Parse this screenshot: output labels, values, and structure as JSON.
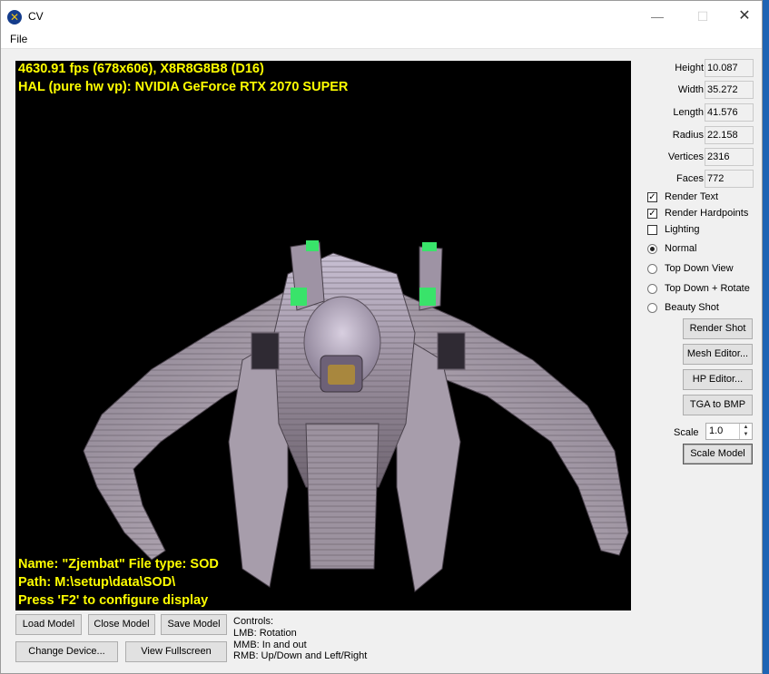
{
  "window": {
    "title": "CV",
    "app_icon_glyph": "✕",
    "minimize_glyph": "—",
    "maximize_glyph": "☐",
    "close_glyph": "✕"
  },
  "menu": {
    "file": "File"
  },
  "viewport": {
    "line1": "4630.91 fps (678x606), X8R8G8B8 (D16)",
    "line2": "HAL (pure hw vp): NVIDIA GeForce RTX 2070 SUPER",
    "name_line": "Name: \"Zjembat\" File type: SOD",
    "path_line": "Path: M:\\setup\\data\\SOD\\",
    "hint_line": "Press 'F2' to configure display",
    "text_color": "#ffff00",
    "background": "#000000"
  },
  "properties": [
    {
      "label": "Height",
      "value": "10.087"
    },
    {
      "label": "Width",
      "value": "35.272"
    },
    {
      "label": "Length",
      "value": "41.576"
    },
    {
      "label": "Radius",
      "value": "22.158"
    },
    {
      "label": "Vertices",
      "value": "2316"
    },
    {
      "label": "Faces",
      "value": "772"
    }
  ],
  "checkboxes": [
    {
      "label": "Render Text",
      "checked": true,
      "mark": "✓"
    },
    {
      "label": "Render Hardpoints",
      "checked": true,
      "mark": "✓"
    },
    {
      "label": "Lighting",
      "checked": false,
      "mark": ""
    }
  ],
  "view_modes": [
    {
      "label": "Normal",
      "selected": true
    },
    {
      "label": "Top Down View",
      "selected": false
    },
    {
      "label": "Top Down + Rotate",
      "selected": false
    },
    {
      "label": "Beauty Shot",
      "selected": false
    }
  ],
  "side_buttons": {
    "render_shot": "Render Shot",
    "mesh_editor": "Mesh Editor...",
    "hp_editor": "HP Editor...",
    "tga_to_bmp": "TGA to BMP",
    "scale_model": "Scale Model"
  },
  "scale": {
    "label": "Scale",
    "value": "1.0",
    "up_glyph": "▲",
    "down_glyph": "▼"
  },
  "bottom_buttons": {
    "load_model": "Load Model",
    "close_model": "Close Model",
    "save_model": "Save Model",
    "change_device": "Change Device...",
    "view_fullscreen": "View Fullscreen"
  },
  "controls": {
    "heading": "Controls:",
    "lmb": "LMB: Rotation",
    "mmb": "MMB: In and out",
    "rmb": "RMB: Up/Down and Left/Right"
  }
}
